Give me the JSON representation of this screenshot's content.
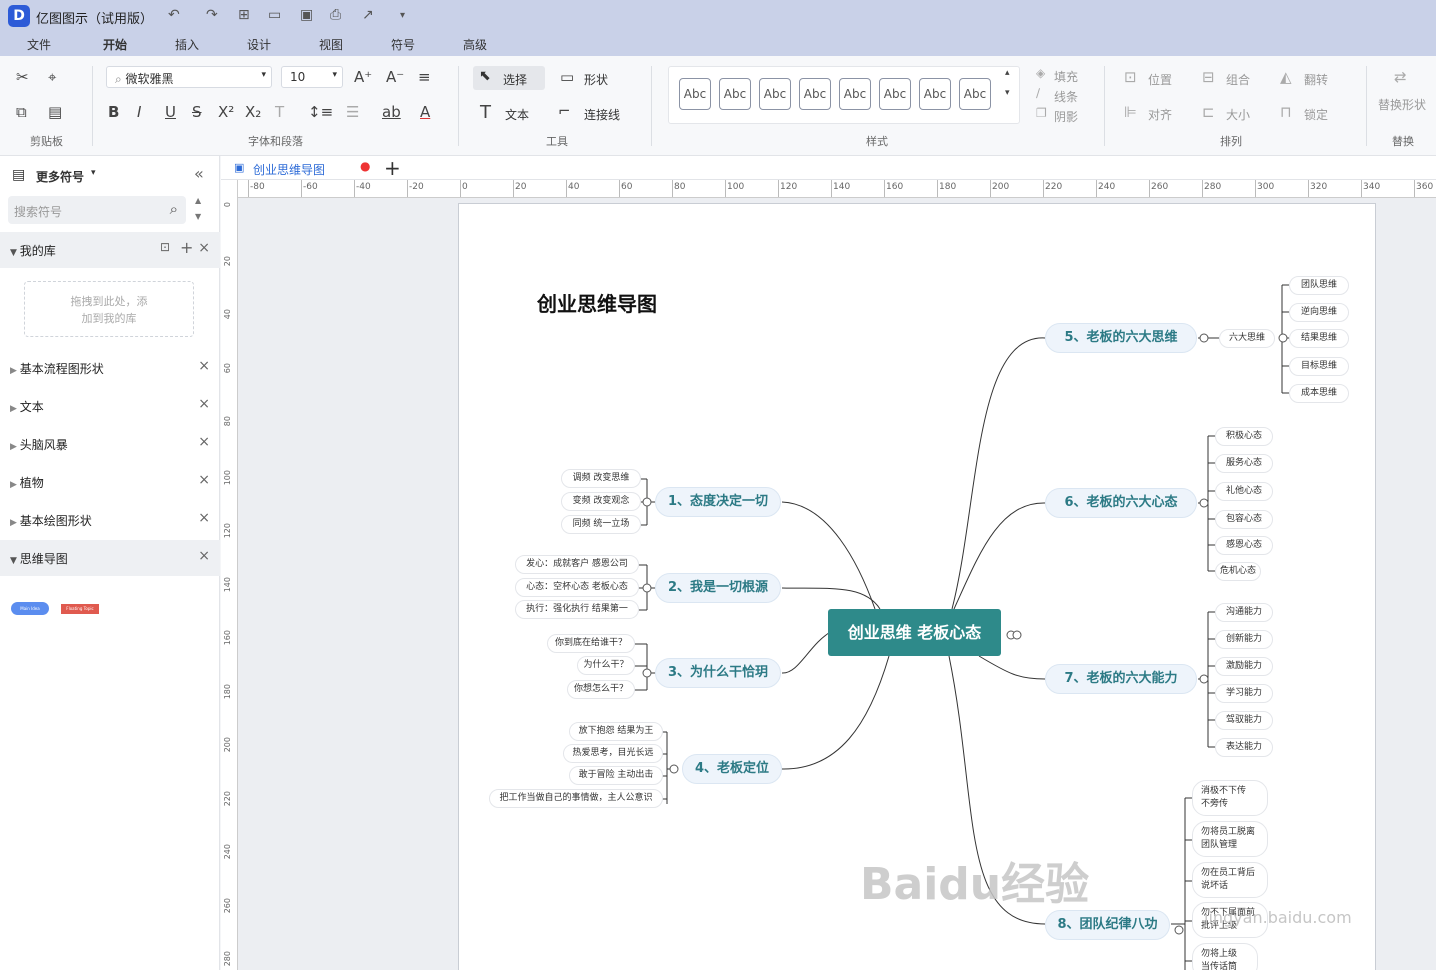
{
  "app": {
    "title": "亿图图示（试用版）"
  },
  "menu": [
    "文件",
    "开始",
    "插入",
    "设计",
    "视图",
    "符号",
    "高级"
  ],
  "ribbon": {
    "font": "微软雅黑",
    "size": "10",
    "labels": {
      "clipboard": "剪贴板",
      "font_para": "字体和段落",
      "tools": "工具",
      "style": "样式",
      "arrange": "排列",
      "replace": "替换"
    },
    "tools": {
      "select": "选择",
      "shape": "形状",
      "text": "文本",
      "connector": "连接线"
    },
    "abc": [
      "Abc",
      "Abc",
      "Abc",
      "Abc",
      "Abc",
      "Abc",
      "Abc",
      "Abc"
    ],
    "fmt": {
      "fill": "填充",
      "line": "线条",
      "shadow": "阴影"
    },
    "arrange": {
      "position": "位置",
      "group": "组合",
      "flip": "翻转",
      "align": "对齐",
      "size": "大小",
      "lock": "锁定"
    },
    "replace_shape": "替换形状"
  },
  "sidebar": {
    "title": "更多符号",
    "search_placeholder": "搜索符号",
    "my_lib": "我的库",
    "drop_hint1": "拖拽到此处，添",
    "drop_hint2": "加到我的库",
    "items": [
      "基本流程图形状",
      "文本",
      "头脑风暴",
      "植物",
      "基本绘图形状",
      "思维导图"
    ],
    "thumb1": "Main Idea",
    "thumb2": "Floating Topic"
  },
  "doc_tab": "创业思维导图",
  "hruler": [
    "-80",
    "-60",
    "-40",
    "-20",
    "0",
    "20",
    "40",
    "60",
    "80",
    "100",
    "120",
    "140",
    "160",
    "180",
    "200",
    "220",
    "240",
    "260",
    "280",
    "300",
    "320",
    "340",
    "360"
  ],
  "vruler": [
    "0",
    "20",
    "40",
    "60",
    "80",
    "100",
    "120",
    "140",
    "160",
    "180",
    "200",
    "220",
    "240",
    "260",
    "280"
  ],
  "mindmap": {
    "title": "创业思维导图",
    "center": "创业思维 老板心态",
    "b1": "1、态度决定一切",
    "b1l": [
      "调频 改变思维",
      "变频 改变观念",
      "同频 统一立场"
    ],
    "b2": "2、我是一切根源",
    "b2l": [
      "发心：成就客户 感恩公司",
      "心态：空杯心态 老板心态",
      "执行：强化执行 结果第一"
    ],
    "b3": "3、为什么干恰玥",
    "b3l": [
      "你到底在给谁干？",
      "为什么干？",
      "你想怎么干？"
    ],
    "b4": "4、老板定位",
    "b4l": [
      "放下抱怨 结果为王",
      "热爱思考，目光长远",
      "敢于冒险 主动出击",
      "把工作当做自己的事情做，主人公意识"
    ],
    "b5": "5、老板的六大思维",
    "b5m": "六大思维",
    "b5l": [
      "团队思维",
      "逆向思维",
      "结果思维",
      "目标思维",
      "成本思维"
    ],
    "b6": "6、老板的六大心态",
    "b6l": [
      "积极心态",
      "服务心态",
      "礼他心态",
      "包容心态",
      "感恩心态",
      "危机心态"
    ],
    "b7": "7、老板的六大能力",
    "b7l": [
      "沟通能力",
      "创新能力",
      "激励能力",
      "学习能力",
      "驾驭能力",
      "表达能力"
    ],
    "b8": "8、团队纪律八功",
    "b8l": [
      [
        "消极不下传",
        "不旁传"
      ],
      [
        "勿将员工脱离",
        "团队管理"
      ],
      [
        "勿在员工背后",
        "说坏话"
      ],
      [
        "勿不下属面前",
        "批评上级"
      ],
      [
        "勿将上级",
        "当传话筒"
      ]
    ]
  },
  "watermark": "Baidu经验",
  "watermark2": "jingyan.baidu.com",
  "colors": {
    "teal": "#2e8a8a",
    "ribbon_bg": "#c9d1e8",
    "accent": "#2d5bd7"
  }
}
